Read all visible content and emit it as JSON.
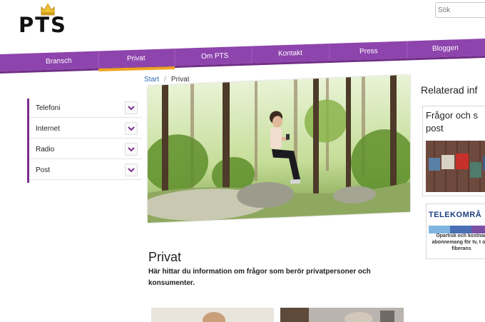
{
  "header": {
    "logo_text": "PTS",
    "search_placeholder": "Sök"
  },
  "nav": {
    "items": [
      "Bransch",
      "Privat",
      "Om PTS",
      "Kontakt",
      "Press",
      "Bloggen"
    ],
    "active_index": 1
  },
  "breadcrumb": {
    "home": "Start",
    "separator": "/",
    "current": "Privat"
  },
  "sidebar": {
    "items": [
      "Telefoni",
      "Internet",
      "Radio",
      "Post"
    ]
  },
  "main": {
    "title": "Privat",
    "lead": "Här hittar du information om frågor som berör privatpersoner och konsumenter."
  },
  "related": {
    "title": "Relaterad inf",
    "card1_text": "Frågor och s post",
    "card2_title": "TELEKOMRÅ",
    "card2_text": "Opartisk och kostnad abonnemang för tv, t och fiberans"
  },
  "colors": {
    "brand_purple": "#8e44ad",
    "nav_active": "#f0a322",
    "link_blue": "#2f6ab3"
  }
}
